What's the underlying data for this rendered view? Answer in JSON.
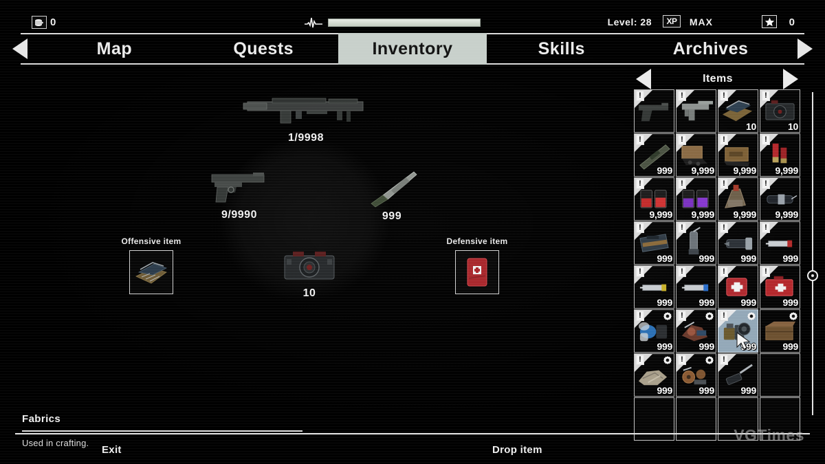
{
  "topbar": {
    "money_icon": "coins-icon",
    "money_value": "0",
    "pulse_icon": "heartbeat-icon",
    "health_percent": 100,
    "level_label": "Level: 28",
    "xp_badge": "XP",
    "xp_value": "MAX",
    "star_icon": "star-icon",
    "star_value": "0"
  },
  "tabs": {
    "prev_icon": "chevron-left-icon",
    "next_icon": "chevron-right-icon",
    "items": [
      {
        "label": "Map",
        "active": false
      },
      {
        "label": "Quests",
        "active": false
      },
      {
        "label": "Inventory",
        "active": true
      },
      {
        "label": "Skills",
        "active": false
      },
      {
        "label": "Archives",
        "active": false
      }
    ]
  },
  "character": {
    "equipment": [
      {
        "slot": "primary-weapon",
        "icon": "assault-rifle-icon",
        "qty": "1/9998"
      },
      {
        "slot": "sidearm",
        "icon": "pistol-icon",
        "qty": "9/9990"
      },
      {
        "slot": "melee",
        "icon": "knife-icon",
        "qty": "999"
      },
      {
        "slot": "gadget",
        "icon": "camera-icon",
        "qty": "10"
      }
    ],
    "offensive": {
      "label": "Offensive item",
      "icon": "bear-trap-icon"
    },
    "defensive": {
      "label": "Defensive item",
      "icon": "first-aid-kit-icon"
    }
  },
  "description": {
    "title": "Fabrics",
    "text": "Used in crafting."
  },
  "items_panel": {
    "title": "Items",
    "prev_icon": "chevron-left-icon",
    "next_icon": "chevron-right-icon",
    "columns": 4,
    "rows": 8,
    "cells": [
      {
        "icon": "pistol-icon",
        "qty": "",
        "new": true,
        "gear": false,
        "selected": false
      },
      {
        "icon": "smg-icon",
        "qty": "",
        "new": true,
        "gear": false,
        "selected": false
      },
      {
        "icon": "bear-trap-icon",
        "qty": "10",
        "new": true,
        "gear": false,
        "selected": false
      },
      {
        "icon": "camera-icon",
        "qty": "10",
        "new": true,
        "gear": false,
        "selected": false
      },
      {
        "icon": "rifle-icon",
        "qty": "999",
        "new": true,
        "gear": false,
        "selected": false
      },
      {
        "icon": "ammo-crate-icon",
        "qty": "9,999",
        "new": true,
        "gear": false,
        "selected": false
      },
      {
        "icon": "ammo-box-icon",
        "qty": "9,999",
        "new": true,
        "gear": false,
        "selected": false
      },
      {
        "icon": "shotgun-shells-icon",
        "qty": "9,999",
        "new": true,
        "gear": false,
        "selected": false
      },
      {
        "icon": "red-chemicals-icon",
        "qty": "9,999",
        "new": true,
        "gear": false,
        "selected": false
      },
      {
        "icon": "purple-chemicals-icon",
        "qty": "9,999",
        "new": true,
        "gear": false,
        "selected": false
      },
      {
        "icon": "molotov-icon",
        "qty": "9,999",
        "new": true,
        "gear": false,
        "selected": false
      },
      {
        "icon": "pipe-bomb-icon",
        "qty": "9,999",
        "new": true,
        "gear": false,
        "selected": false
      },
      {
        "icon": "toolbox-icon",
        "qty": "999",
        "new": true,
        "gear": false,
        "selected": false
      },
      {
        "icon": "grenade-icon",
        "qty": "999",
        "new": true,
        "gear": false,
        "selected": false
      },
      {
        "icon": "flashlight-icon",
        "qty": "999",
        "new": true,
        "gear": false,
        "selected": false
      },
      {
        "icon": "red-syringe-icon",
        "qty": "999",
        "new": true,
        "gear": false,
        "selected": false
      },
      {
        "icon": "yellow-syringe-icon",
        "qty": "999",
        "new": true,
        "gear": false,
        "selected": false
      },
      {
        "icon": "blue-syringe-icon",
        "qty": "999",
        "new": true,
        "gear": false,
        "selected": false
      },
      {
        "icon": "first-aid-kit-icon",
        "qty": "999",
        "new": true,
        "gear": false,
        "selected": false
      },
      {
        "icon": "medical-case-icon",
        "qty": "999",
        "new": true,
        "gear": false,
        "selected": false
      },
      {
        "icon": "plastics-icon",
        "qty": "999",
        "new": true,
        "gear": true,
        "selected": false
      },
      {
        "icon": "scrap-parts-icon",
        "qty": "999",
        "new": true,
        "gear": true,
        "selected": false
      },
      {
        "icon": "mechanical-parts-icon",
        "qty": "999",
        "new": true,
        "gear": true,
        "selected": true
      },
      {
        "icon": "wood-crate-icon",
        "qty": "999",
        "new": false,
        "gear": true,
        "selected": false
      },
      {
        "icon": "fabrics-icon",
        "qty": "999",
        "new": true,
        "gear": true,
        "selected": false
      },
      {
        "icon": "metal-parts-icon",
        "qty": "999",
        "new": true,
        "gear": true,
        "selected": false
      },
      {
        "icon": "screwdriver-icon",
        "qty": "999",
        "new": true,
        "gear": false,
        "selected": false
      },
      {
        "icon": "",
        "qty": "",
        "new": false,
        "gear": false,
        "selected": false
      },
      {
        "icon": "",
        "qty": "",
        "new": false,
        "gear": false,
        "selected": false
      },
      {
        "icon": "",
        "qty": "",
        "new": false,
        "gear": false,
        "selected": false
      },
      {
        "icon": "",
        "qty": "",
        "new": false,
        "gear": false,
        "selected": false
      },
      {
        "icon": "",
        "qty": "",
        "new": false,
        "gear": false,
        "selected": false
      }
    ],
    "scrollbar": {
      "thumb_position_percent": 57
    }
  },
  "bottombar": {
    "exit_label": "Exit",
    "drop_label": "Drop item"
  },
  "watermark": {
    "text": "VGTimes"
  },
  "colors": {
    "background": "#000000",
    "text": "#efefef",
    "active_tab_bg": "#c8d0cb",
    "selected_cell": "#93a8b8",
    "rule": "#e2e2e2"
  }
}
